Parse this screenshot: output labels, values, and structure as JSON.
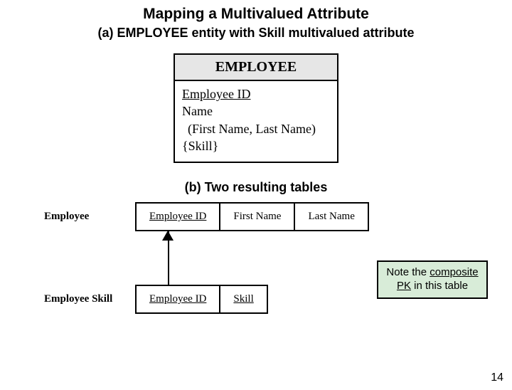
{
  "title": "Mapping a Multivalued Attribute",
  "section_a": "(a) EMPLOYEE entity with Skill multivalued attribute",
  "entity": {
    "name": "EMPLOYEE",
    "pk": "Employee ID",
    "attr_name": "Name",
    "attr_name_parts": " (First Name, Last Name)",
    "attr_multivalued": "{Skill}"
  },
  "section_b": "(b) Two resulting tables",
  "tables": {
    "employee": {
      "label": "Employee",
      "cols": [
        "Employee ID",
        "First Name",
        "Last Name"
      ],
      "pk_indices": [
        0
      ]
    },
    "employee_skill": {
      "label": "Employee Skill",
      "cols": [
        "Employee ID",
        "Skill"
      ],
      "pk_indices": [
        0,
        1
      ]
    }
  },
  "note": {
    "pre": "Note the ",
    "underlined": "composite PK",
    "post": " in this table"
  },
  "page_number": "14",
  "colors": {
    "note_bg": "#d8ecd8",
    "entity_header_bg": "#e6e6e6"
  }
}
